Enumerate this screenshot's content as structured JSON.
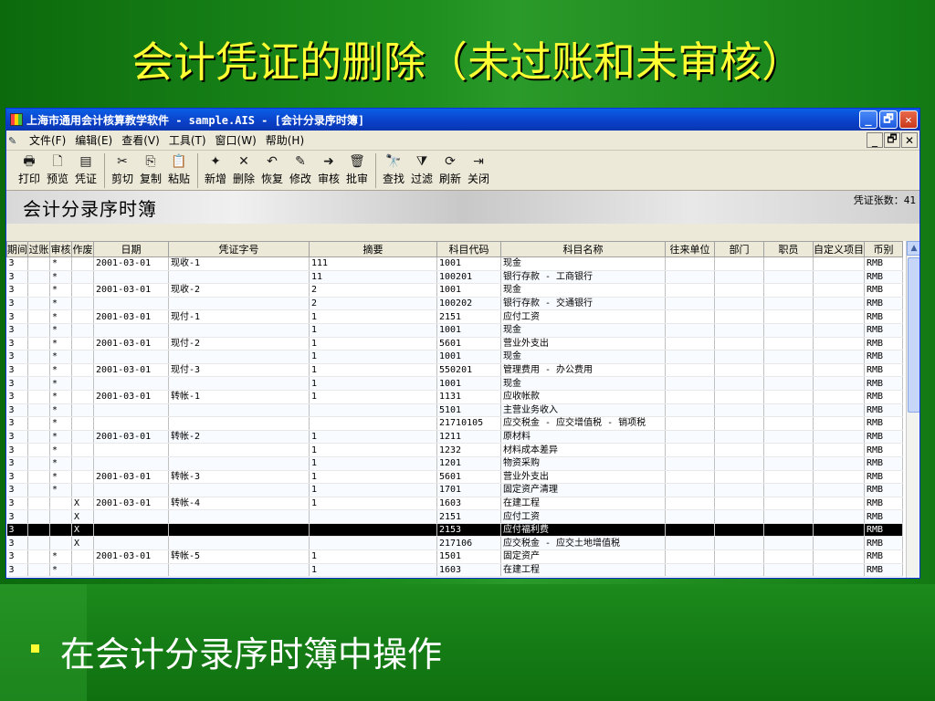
{
  "slide": {
    "title": "会计凭证的删除（未过账和未审核）",
    "bullet": "在会计分录序时簿中操作"
  },
  "window": {
    "title": "上海市通用会计核算教学软件 - sample.AIS - [会计分录序时簿]",
    "controls": {
      "minimize": "_",
      "restore": "🗗",
      "close": "✕"
    },
    "mdi_controls": {
      "minimize": "_",
      "restore": "🗗",
      "close": "✕"
    }
  },
  "menu": [
    {
      "id": "file",
      "label": "文件(F)"
    },
    {
      "id": "edit",
      "label": "编辑(E)"
    },
    {
      "id": "view",
      "label": "查看(V)"
    },
    {
      "id": "tools",
      "label": "工具(T)"
    },
    {
      "id": "window",
      "label": "窗口(W)"
    },
    {
      "id": "help",
      "label": "帮助(H)"
    }
  ],
  "toolbar": [
    {
      "id": "print",
      "label": "打印",
      "icon": "printer-icon",
      "glyph": "🖶"
    },
    {
      "id": "preview",
      "label": "预览",
      "icon": "preview-icon",
      "glyph": "🗋"
    },
    {
      "id": "voucher",
      "label": "凭证",
      "icon": "voucher-icon",
      "glyph": "▤"
    },
    {
      "sep": true
    },
    {
      "id": "cut",
      "label": "剪切",
      "icon": "cut-icon",
      "glyph": "✂"
    },
    {
      "id": "copy",
      "label": "复制",
      "icon": "copy-icon",
      "glyph": "⎘"
    },
    {
      "id": "paste",
      "label": "粘贴",
      "icon": "paste-icon",
      "glyph": "📋"
    },
    {
      "sep": true
    },
    {
      "id": "new",
      "label": "新增",
      "icon": "new-icon",
      "glyph": "✦"
    },
    {
      "id": "delete",
      "label": "删除",
      "icon": "delete-icon",
      "glyph": "✕"
    },
    {
      "id": "restore",
      "label": "恢复",
      "icon": "undo-icon",
      "glyph": "↶"
    },
    {
      "id": "modify",
      "label": "修改",
      "icon": "edit-icon",
      "glyph": "✎"
    },
    {
      "id": "audit",
      "label": "审核",
      "icon": "audit-icon",
      "glyph": "➜"
    },
    {
      "id": "approve",
      "label": "批审",
      "icon": "trash-icon",
      "glyph": "🗑"
    },
    {
      "sep": true
    },
    {
      "id": "find",
      "label": "查找",
      "icon": "binoculars-icon",
      "glyph": "🔭"
    },
    {
      "id": "filter",
      "label": "过滤",
      "icon": "filter-icon",
      "glyph": "⧩"
    },
    {
      "id": "refresh",
      "label": "刷新",
      "icon": "refresh-icon",
      "glyph": "⟳"
    },
    {
      "id": "closewin",
      "label": "关闭",
      "icon": "exit-icon",
      "glyph": "⇥"
    }
  ],
  "banner": {
    "title": "会计分录序时簿",
    "voucher_count": "凭证张数：41"
  },
  "grid": {
    "columns": [
      "期间",
      "过账",
      "审核",
      "作废",
      "日期",
      "凭证字号",
      "摘要",
      "科目代码",
      "科目名称",
      "往来单位",
      "部门",
      "职员",
      "自定义项目",
      "币别"
    ],
    "selected_row": 18,
    "rows": [
      [
        "3",
        "",
        "*",
        "",
        "2001-03-01",
        "现收-1",
        "111",
        "1001",
        "现金",
        "",
        "",
        "",
        "",
        "RMB"
      ],
      [
        "3",
        "",
        "*",
        "",
        "",
        "",
        "11",
        "100201",
        "银行存款 - 工商银行",
        "",
        "",
        "",
        "",
        "RMB"
      ],
      [
        "3",
        "",
        "*",
        "",
        "2001-03-01",
        "现收-2",
        "2",
        "1001",
        "现金",
        "",
        "",
        "",
        "",
        "RMB"
      ],
      [
        "3",
        "",
        "*",
        "",
        "",
        "",
        "2",
        "100202",
        "银行存款 - 交通银行",
        "",
        "",
        "",
        "",
        "RMB"
      ],
      [
        "3",
        "",
        "*",
        "",
        "2001-03-01",
        "现付-1",
        "1",
        "2151",
        "应付工资",
        "",
        "",
        "",
        "",
        "RMB"
      ],
      [
        "3",
        "",
        "*",
        "",
        "",
        "",
        "1",
        "1001",
        "现金",
        "",
        "",
        "",
        "",
        "RMB"
      ],
      [
        "3",
        "",
        "*",
        "",
        "2001-03-01",
        "现付-2",
        "1",
        "5601",
        "营业外支出",
        "",
        "",
        "",
        "",
        "RMB"
      ],
      [
        "3",
        "",
        "*",
        "",
        "",
        "",
        "1",
        "1001",
        "现金",
        "",
        "",
        "",
        "",
        "RMB"
      ],
      [
        "3",
        "",
        "*",
        "",
        "2001-03-01",
        "现付-3",
        "1",
        "550201",
        "管理费用 - 办公费用",
        "",
        "",
        "",
        "",
        "RMB"
      ],
      [
        "3",
        "",
        "*",
        "",
        "",
        "",
        "1",
        "1001",
        "现金",
        "",
        "",
        "",
        "",
        "RMB"
      ],
      [
        "3",
        "",
        "*",
        "",
        "2001-03-01",
        "转帐-1",
        "1",
        "1131",
        "应收帐款",
        "",
        "",
        "",
        "",
        "RMB"
      ],
      [
        "3",
        "",
        "*",
        "",
        "",
        "",
        "",
        "5101",
        "主营业务收入",
        "",
        "",
        "",
        "",
        "RMB"
      ],
      [
        "3",
        "",
        "*",
        "",
        "",
        "",
        "",
        "21710105",
        "应交税金 - 应交增值税 - 销项税",
        "",
        "",
        "",
        "",
        "RMB"
      ],
      [
        "3",
        "",
        "*",
        "",
        "2001-03-01",
        "转帐-2",
        "1",
        "1211",
        "原材料",
        "",
        "",
        "",
        "",
        "RMB"
      ],
      [
        "3",
        "",
        "*",
        "",
        "",
        "",
        "1",
        "1232",
        "材料成本差异",
        "",
        "",
        "",
        "",
        "RMB"
      ],
      [
        "3",
        "",
        "*",
        "",
        "",
        "",
        "1",
        "1201",
        "物资采购",
        "",
        "",
        "",
        "",
        "RMB"
      ],
      [
        "3",
        "",
        "*",
        "",
        "2001-03-01",
        "转帐-3",
        "1",
        "5601",
        "营业外支出",
        "",
        "",
        "",
        "",
        "RMB"
      ],
      [
        "3",
        "",
        "*",
        "",
        "",
        "",
        "1",
        "1701",
        "固定资产清理",
        "",
        "",
        "",
        "",
        "RMB"
      ],
      [
        "3",
        "",
        "",
        "X",
        "2001-03-01",
        "转帐-4",
        "1",
        "1603",
        "在建工程",
        "",
        "",
        "",
        "",
        "RMB"
      ],
      [
        "3",
        "",
        "",
        "X",
        "",
        "",
        "",
        "2151",
        "应付工资",
        "",
        "",
        "",
        "",
        "RMB"
      ],
      [
        "3",
        "",
        "",
        "X",
        "",
        "",
        "",
        "2153",
        "应付福利费",
        "",
        "",
        "",
        "",
        "RMB"
      ],
      [
        "3",
        "",
        "",
        "X",
        "",
        "",
        "",
        "217106",
        "应交税金 - 应交土地增值税",
        "",
        "",
        "",
        "",
        "RMB"
      ],
      [
        "3",
        "",
        "*",
        "",
        "2001-03-01",
        "转帐-5",
        "1",
        "1501",
        "固定资产",
        "",
        "",
        "",
        "",
        "RMB"
      ],
      [
        "3",
        "",
        "*",
        "",
        "",
        "",
        "1",
        "1603",
        "在建工程",
        "",
        "",
        "",
        "",
        "RMB"
      ]
    ]
  }
}
